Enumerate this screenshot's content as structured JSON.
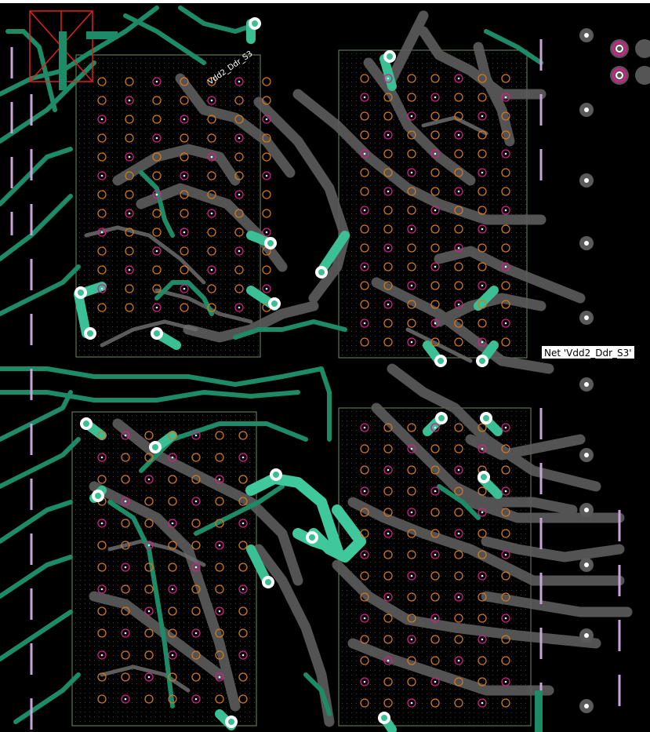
{
  "tooltip": {
    "text": "Net 'Vdd2_Ddr_S3'"
  },
  "silkscreen_label": "Vdd2_Ddr_S3",
  "colors": {
    "background": "#000000",
    "copper_green": "#1f8f6f",
    "copper_green_bright": "#43c9a0",
    "grey_trace": "#5b5b5b",
    "grey_trace_light": "#7a7a7a",
    "via_orange": "#d1781e",
    "via_magenta": "#d0208a",
    "keepout_pink": "#c9a6d6",
    "outline": "#8fa27a",
    "marker_red": "#e0201a"
  },
  "icons": {
    "via": "via-icon",
    "pad": "pad-icon",
    "mount_hole": "mounting-hole-icon"
  }
}
